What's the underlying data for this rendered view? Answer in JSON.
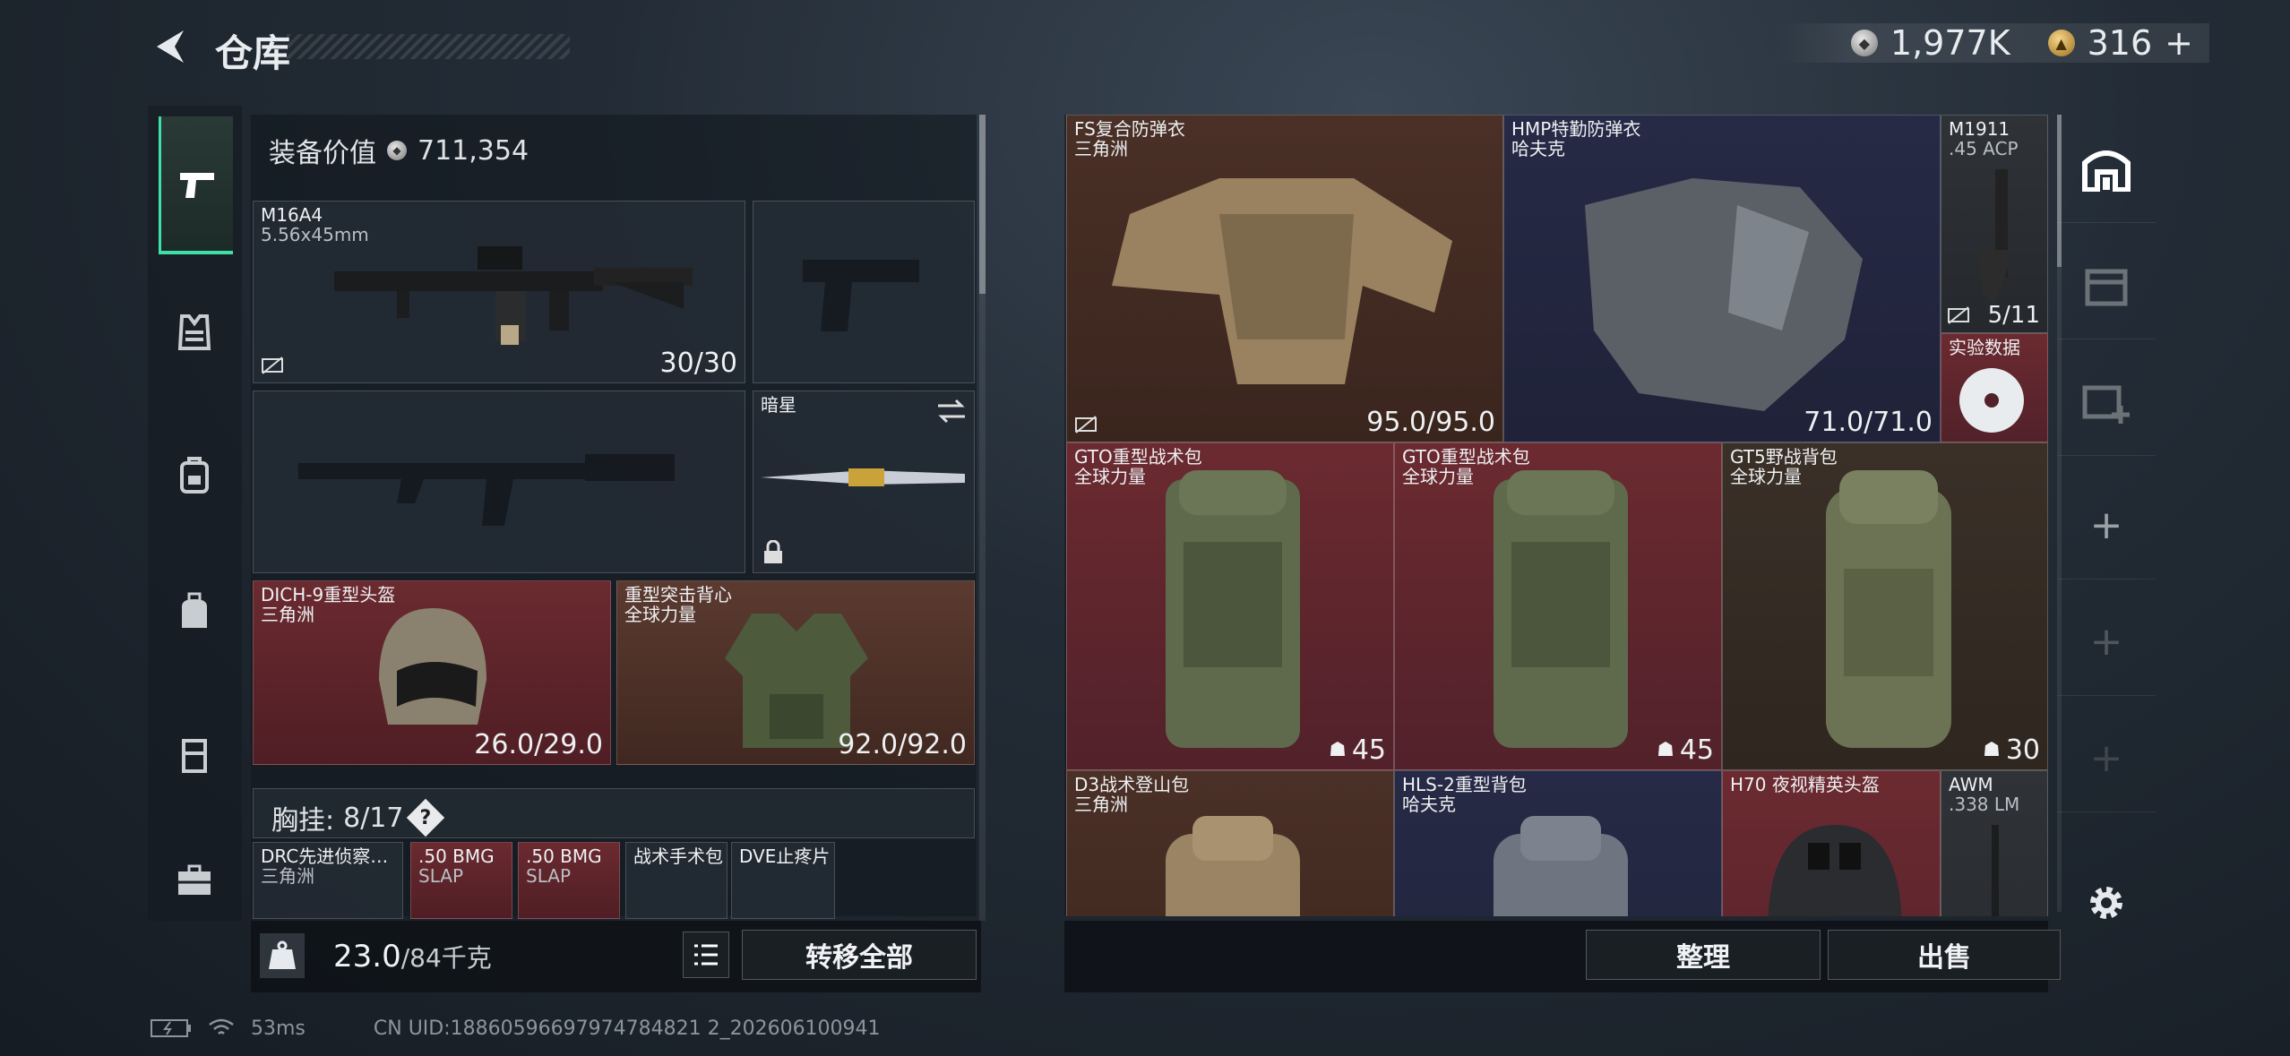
{
  "header": {
    "title": "仓库",
    "currency_silver": "1,977K",
    "currency_gold": "316",
    "gold_add": "+"
  },
  "left_nav": {
    "items": [
      "pistol-icon",
      "vest-icon",
      "backpack-icon",
      "bag-icon",
      "container-icon",
      "briefcase-icon"
    ]
  },
  "loadout": {
    "value_label": "装备价值",
    "value": "711,354",
    "primary": {
      "name": "M16A4",
      "ammo": "5.56x45mm",
      "count": "30/30"
    },
    "melee": {
      "name": "暗星"
    },
    "helmet": {
      "name": "DICH-9重型头盔",
      "origin": "三角洲",
      "durability": "26.0/29.0"
    },
    "vest": {
      "name": "重型突击背心",
      "origin": "全球力量",
      "durability": "92.0/92.0"
    },
    "chest_rig_label": "胸挂:",
    "chest_rig_count": "8/17",
    "chest_rig_help": "?",
    "rig_items": [
      {
        "name": "DRC先进侦察…",
        "sub": "三角洲"
      },
      {
        "name": ".50 BMG",
        "sub": "SLAP"
      },
      {
        "name": ".50 BMG",
        "sub": "SLAP"
      },
      {
        "name": "战术手术包",
        "sub": ""
      },
      {
        "name": "DVE止疼片",
        "sub": ""
      }
    ],
    "weight": "23.0",
    "weight_max": "/84千克",
    "transfer_all": "转移全部"
  },
  "stash": {
    "items": [
      {
        "name": "FS复合防弹衣",
        "origin": "三角洲",
        "value": "95.0/95.0"
      },
      {
        "name": "HMP特勤防弹衣",
        "origin": "哈夫克",
        "value": "71.0/71.0"
      },
      {
        "name": "M1911",
        "origin": ".45 ACP",
        "value": "5/11"
      },
      {
        "name": "实验数据",
        "origin": "",
        "value": ""
      },
      {
        "name": "GTO重型战术包",
        "origin": "全球力量",
        "value": "45"
      },
      {
        "name": "GTO重型战术包",
        "origin": "全球力量",
        "value": "45"
      },
      {
        "name": "GT5野战背包",
        "origin": "全球力量",
        "value": "30"
      },
      {
        "name": "D3战术登山包",
        "origin": "三角洲",
        "value": ""
      },
      {
        "name": "HLS-2重型背包",
        "origin": "哈夫克",
        "value": ""
      },
      {
        "name": "H70 夜视精英头盔",
        "origin": "",
        "value": ""
      },
      {
        "name": "AWM",
        "origin": ".338 LM",
        "value": ""
      }
    ],
    "sort_button": "整理",
    "sell_button": "出售"
  },
  "status": {
    "ping": "53ms",
    "uid": "CN UID:18860596697974784821 2_202606100941"
  },
  "colors": {
    "accent": "#3fe0a8",
    "slot_red": "#6a2a30",
    "slot_brown": "#4a3026",
    "slot_navy": "#262a46"
  }
}
